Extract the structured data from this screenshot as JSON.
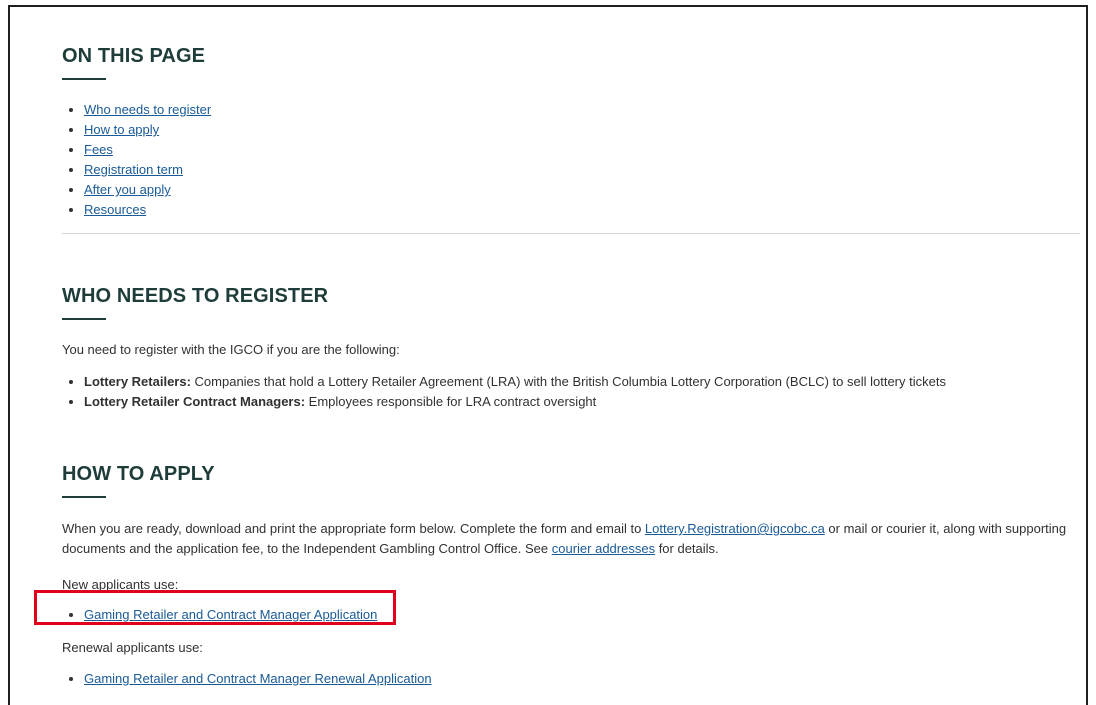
{
  "on_this_page": {
    "title": "ON THIS PAGE",
    "links": [
      "Who needs to register",
      "How to apply",
      "Fees",
      "Registration term",
      "After you apply",
      "Resources"
    ]
  },
  "who": {
    "title": "WHO NEEDS TO REGISTER",
    "intro": "You need to register with the IGCO if you are the following:",
    "items": [
      {
        "term": "Lottery Retailers:",
        "text": " Companies that hold a Lottery Retailer Agreement (LRA) with the British Columbia Lottery Corporation (BCLC) to sell lottery tickets"
      },
      {
        "term": "Lottery Retailer Contract Managers:",
        "text": " Employees responsible for LRA contract oversight"
      }
    ]
  },
  "how": {
    "title": "HOW TO APPLY",
    "para_1": "When you are ready, download and print the appropriate form below. Complete the form and email to ",
    "email": "Lottery.Registration@igcobc.ca",
    "para_2": " or mail or courier it, along with supporting documents and the application fee, to the Independent Gambling Control Office. See ",
    "courier_link": "courier addresses",
    "para_3": " for details.",
    "new_label": "New applicants use:",
    "new_link": "Gaming Retailer and Contract Manager Application",
    "renewal_label": "Renewal applicants use:",
    "renewal_link": "Gaming Retailer and Contract Manager Renewal Application"
  },
  "colors": {
    "heading": "#1e3d3a",
    "link": "#1a5a96",
    "highlight": "#e0001b"
  }
}
